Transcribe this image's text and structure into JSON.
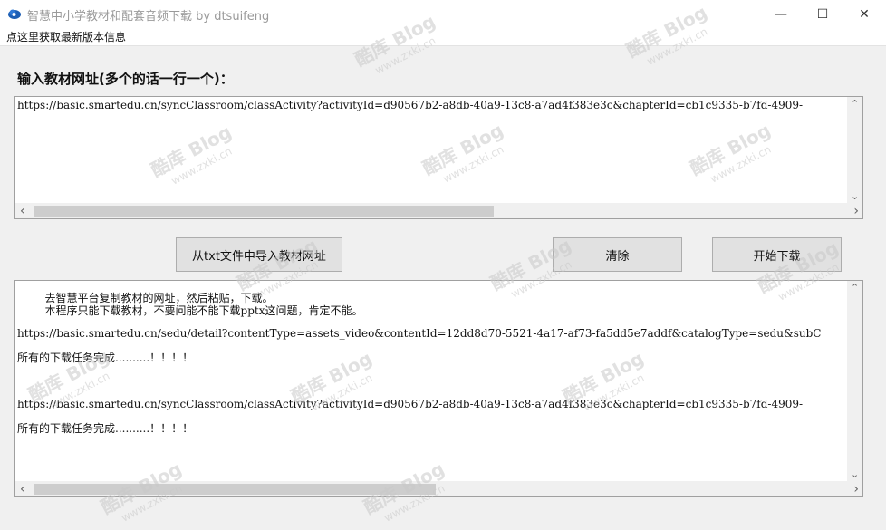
{
  "window": {
    "title": "智慧中小学教材和配套音频下载 by dtsuifeng",
    "minimize_glyph": "—",
    "maximize_glyph": "☐",
    "close_glyph": "✕"
  },
  "menu": {
    "update_link": "点这里获取最新版本信息"
  },
  "input_section": {
    "label": "输入教材网址(多个的话一行一个)：",
    "value": "https://basic.smartedu.cn/syncClassroom/classActivity?activityId=d90567b2-a8db-40a9-13c8-a7ad4f383e3c&chapterId=cb1c9335-b7fd-4909-"
  },
  "buttons": {
    "import_label": "从txt文件中导入教材网址",
    "clear_label": "清除",
    "start_label": "开始下载"
  },
  "log": {
    "intro_line1": "        去智慧平台复制教材的网址，然后粘贴，下载。",
    "intro_line2": "        本程序只能下载教材，不要问能不能下载pptx这问题，肯定不能。",
    "url1": "https://basic.smartedu.cn/sedu/detail?contentType=assets_video&contentId=12dd8d70-5521-4a17-af73-fa5dd5e7addf&catalogType=sedu&subC",
    "done1": "所有的下载任务完成..........！！！！",
    "url2": "https://basic.smartedu.cn/syncClassroom/classActivity?activityId=d90567b2-a8db-40a9-13c8-a7ad4f383e3c&chapterId=cb1c9335-b7fd-4909-",
    "done2": "所有的下载任务完成..........！！！！"
  },
  "scroll_glyphs": {
    "up": "⌃",
    "down": "⌄",
    "left": "‹",
    "right": "›"
  },
  "watermark": {
    "brand": "酷库 Blog",
    "site": "www.zxki.cn"
  },
  "colors": {
    "title_text": "#9a9a9a",
    "button_face": "#e1e1e1",
    "scroll_thumb": "#cdcdcd"
  }
}
